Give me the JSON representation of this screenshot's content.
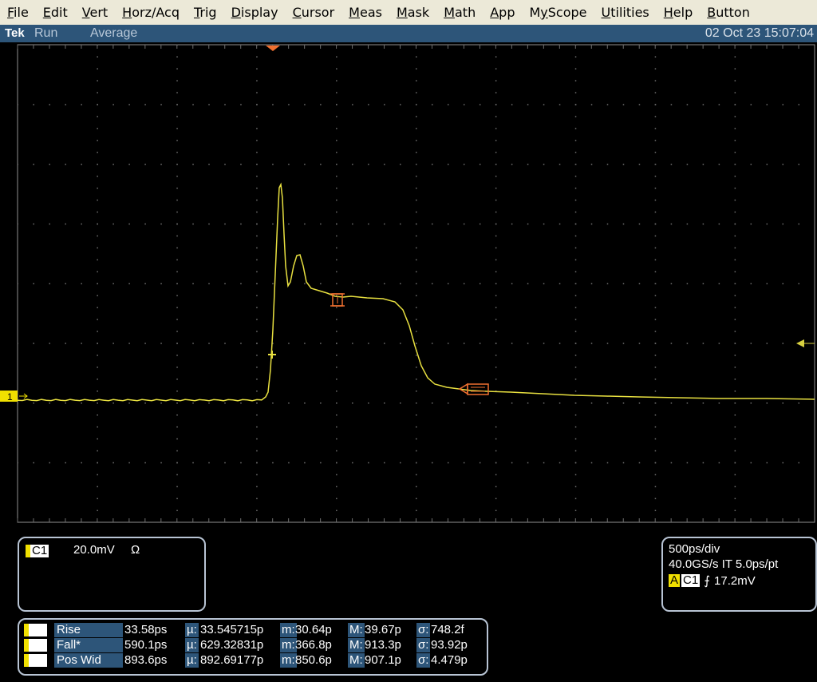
{
  "menu": [
    "File",
    "Edit",
    "Vert",
    "Horz/Acq",
    "Trig",
    "Display",
    "Cursor",
    "Meas",
    "Mask",
    "Math",
    "App",
    "MyScope",
    "Utilities",
    "Help",
    "Button"
  ],
  "menu_underline": [
    0,
    0,
    0,
    0,
    0,
    0,
    0,
    0,
    0,
    0,
    0,
    1,
    0,
    0,
    0
  ],
  "status": {
    "brand": "Tek",
    "state": "Run",
    "mode": "Average",
    "datetime": "02 Oct 23 15:07:04"
  },
  "channel_marker": "1",
  "ref_markers": {
    "a": "⊡",
    "b": "⊡"
  },
  "channel_box": {
    "tag": "C1",
    "scale": "20.0mV",
    "impedance": "Ω"
  },
  "horiz_box": {
    "timebase": "500ps/div",
    "sample": "40.0GS/s IT 5.0ps/pt",
    "trig_tag": "A",
    "trig_src": "C1",
    "trig_slope": "⨍",
    "trig_level": "17.2mV"
  },
  "measurements": [
    {
      "ch": "C1",
      "name": "Rise",
      "value": "33.58ps",
      "mean_lbl": "µ:",
      "mean": "33.545715p",
      "min_lbl": "m:",
      "min": "30.64p",
      "max_lbl": "M:",
      "max": "39.67p",
      "sd_lbl": "σ:",
      "sd": "748.2f"
    },
    {
      "ch": "C1",
      "name": "Fall*",
      "value": "590.1ps",
      "mean_lbl": "µ:",
      "mean": "629.32831p",
      "min_lbl": "m:",
      "min": "366.8p",
      "max_lbl": "M:",
      "max": "913.3p",
      "sd_lbl": "σ:",
      "sd": "93.92p"
    },
    {
      "ch": "C1",
      "name": "Pos Wid",
      "value": "893.6ps",
      "mean_lbl": "µ:",
      "mean": "892.69177p",
      "min_lbl": "m:",
      "min": "850.6p",
      "max_lbl": "M:",
      "max": "907.1p",
      "sd_lbl": "σ:",
      "sd": "4.479p"
    }
  ],
  "colors": {
    "trace": "#e8e040",
    "grid": "#707070",
    "accent": "#f07030",
    "status_bg": "#2d5579",
    "channel": "#f0e000"
  }
}
